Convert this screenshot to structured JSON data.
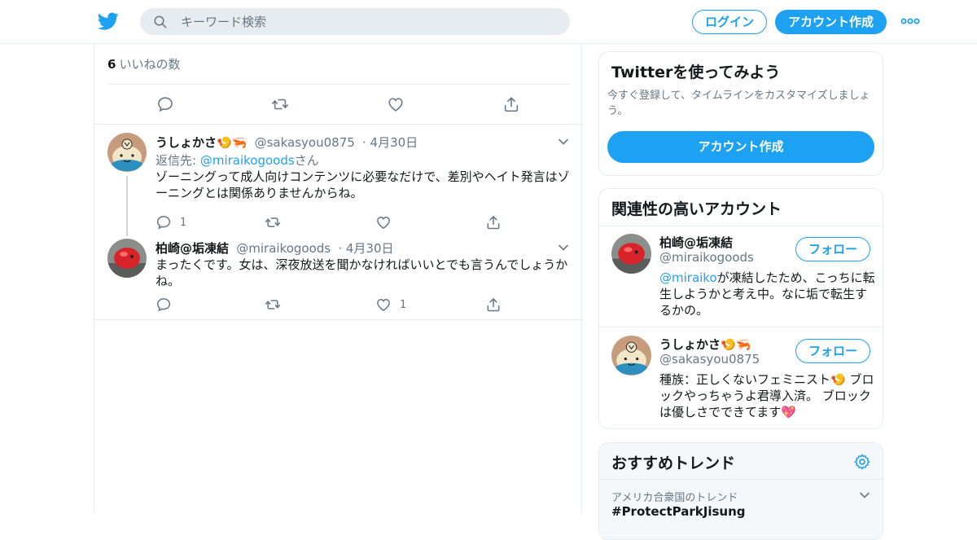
{
  "search": {
    "placeholder": "キーワード検索"
  },
  "header": {
    "login_label": "ログイン",
    "signup_label": "アカウント作成"
  },
  "colors": {
    "accent": "#1da1f2",
    "muted": "#657786",
    "text": "#14171a",
    "border": "#e6ecf0"
  },
  "main_tweet": {
    "likes_count": "6",
    "likes_label": "いいねの数"
  },
  "replies": [
    {
      "name": "うしょかさ",
      "emoji": "🍤🦐",
      "handle": "@sakasyou0875",
      "date": "· 4月30日",
      "reply_to_prefix": "返信先: ",
      "reply_to_handle": "@miraikogoods",
      "reply_to_suffix": "さん",
      "text": "ゾーニングって成人向けコンテンツに必要なだけで、差別やヘイト発言はゾーニングとは関係ありませんからね。",
      "reply_count": "1",
      "retweet_count": "",
      "like_count": ""
    },
    {
      "name": "柏崎@垢凍結",
      "handle": "@miraikogoods",
      "date": "· 4月30日",
      "text": "まったくです。女は、深夜放送を聞かなければいいとでも言うんでしょうかね。",
      "reply_count": "",
      "retweet_count": "",
      "like_count": "1"
    }
  ],
  "sidebar": {
    "join_title": "Twitterを使ってみよう",
    "join_text": "今すぐ登録して、タイムラインをカスタマイズしましょう。",
    "join_button": "アカウント作成",
    "related_title": "関連性の高いアカウント",
    "follow_label": "フォロー",
    "accounts": [
      {
        "name": "柏崎@垢凍結",
        "handle": "@miraikogoods",
        "bio_link": "@miraiko",
        "bio_text": "が凍結したため、こっちに転生しようかと考え中。なに垢で転生するかの。"
      },
      {
        "name": "うしょかさ🍤🦐",
        "handle": "@sakasyou0875",
        "bio_text": "種族：正しくないフェミニスト🍤 ブロックやっちゃうよ君導入済。 ブロックは優しさでできてます💖"
      }
    ],
    "trends_title": "おすすめトレンド",
    "trend_context": "アメリカ合衆国のトレンド",
    "trend_tag": "#ProtectParkJisung"
  }
}
